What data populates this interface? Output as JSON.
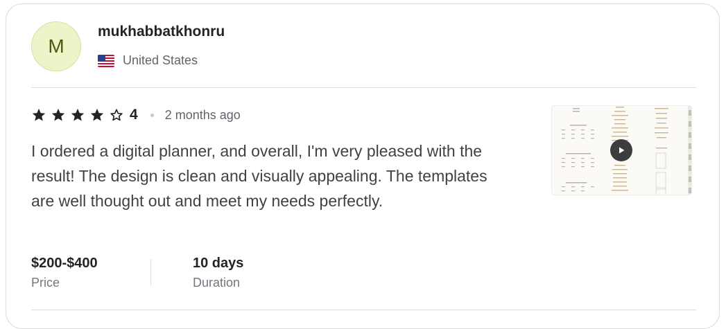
{
  "reviewer": {
    "avatar_initial": "M",
    "username": "mukhabbatkhonru",
    "country": "United States",
    "flag_icon": "us-flag-icon"
  },
  "review": {
    "rating": 4,
    "stars_filled": 4,
    "stars_total": 5,
    "rating_label": "4",
    "time_ago": "2 months ago",
    "text": "I ordered a digital planner, and overall, I'm very pleased with the result! The design is clean and visually appealing. The templates are well thought out and meet my needs perfectly."
  },
  "attachment": {
    "type": "video",
    "icon": "play-icon"
  },
  "details": {
    "price_value": "$200-$400",
    "price_label": "Price",
    "duration_value": "10 days",
    "duration_label": "Duration"
  },
  "colors": {
    "star": "#222325",
    "avatar_bg": "#eef3c8",
    "avatar_text": "#4b5c12"
  }
}
